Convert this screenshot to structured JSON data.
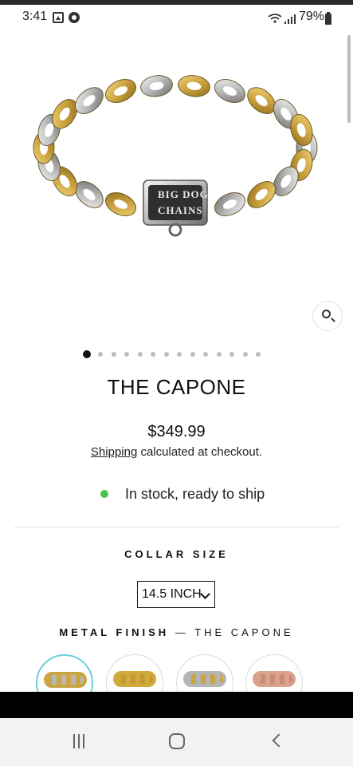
{
  "status_bar": {
    "time": "3:41",
    "battery": "79%",
    "icons": [
      "gallery-icon",
      "chrome-icon",
      "wifi-icon",
      "signal-icon",
      "battery-icon"
    ]
  },
  "product": {
    "image_logo_text": "BIG DOG CHAINS",
    "title": "THE CAPONE",
    "price": "$349.99",
    "shipping_link": "Shipping",
    "shipping_rest": " calculated at checkout.",
    "stock": "In stock, ready to ship",
    "gallery_total": 14,
    "gallery_active_index": 1
  },
  "options": {
    "collar_size_label": "COLLAR SIZE",
    "collar_size_value": "14.5 INCH",
    "metal_finish_label": "METAL FINISH",
    "metal_finish_separator": " — ",
    "metal_finish_value": "THE CAPONE",
    "swatches": [
      {
        "name": "gold-steel",
        "colors": [
          "#c9a545",
          "#b8b8b8"
        ]
      },
      {
        "name": "gold",
        "colors": [
          "#d1aa3b",
          "#c49a33"
        ]
      },
      {
        "name": "steel-gold",
        "colors": [
          "#b5b5b5",
          "#caa642"
        ]
      },
      {
        "name": "rose-gold",
        "colors": [
          "#d9a28c",
          "#c98a76"
        ]
      }
    ]
  },
  "colors": {
    "in_stock_dot": "#47c64a",
    "active_swatch_ring": "#6fd1d8"
  },
  "nav": {
    "icons": [
      "recent-apps-icon",
      "home-icon",
      "back-icon"
    ]
  }
}
